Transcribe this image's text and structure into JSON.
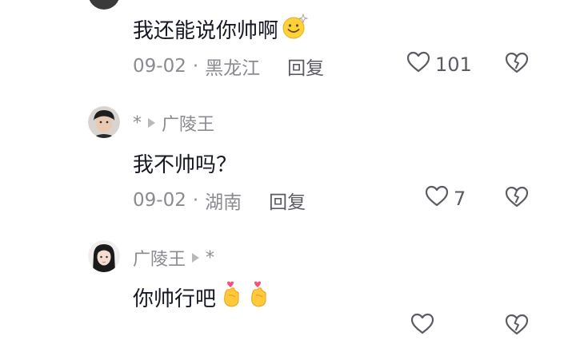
{
  "comments": [
    {
      "text": "我还能说你帅啊",
      "emoji": "smiling-face-emoji",
      "date": "09-02",
      "separator": "·",
      "location": "黑龙江",
      "reply_label": "回复",
      "likes": "101"
    },
    {
      "author": "广陵王",
      "prefix_mark": "*",
      "text": "我不帅吗？",
      "date": "09-02",
      "separator": "·",
      "location": "湖南",
      "reply_label": "回复",
      "likes": "7"
    },
    {
      "author": "广陵王",
      "suffix_mark": "*",
      "text": "你帅行吧",
      "emoji": "finger-heart-emoji"
    }
  ],
  "colors": {
    "background": "#ffffff",
    "text": "#161823",
    "secondary": "#8a8b91"
  }
}
